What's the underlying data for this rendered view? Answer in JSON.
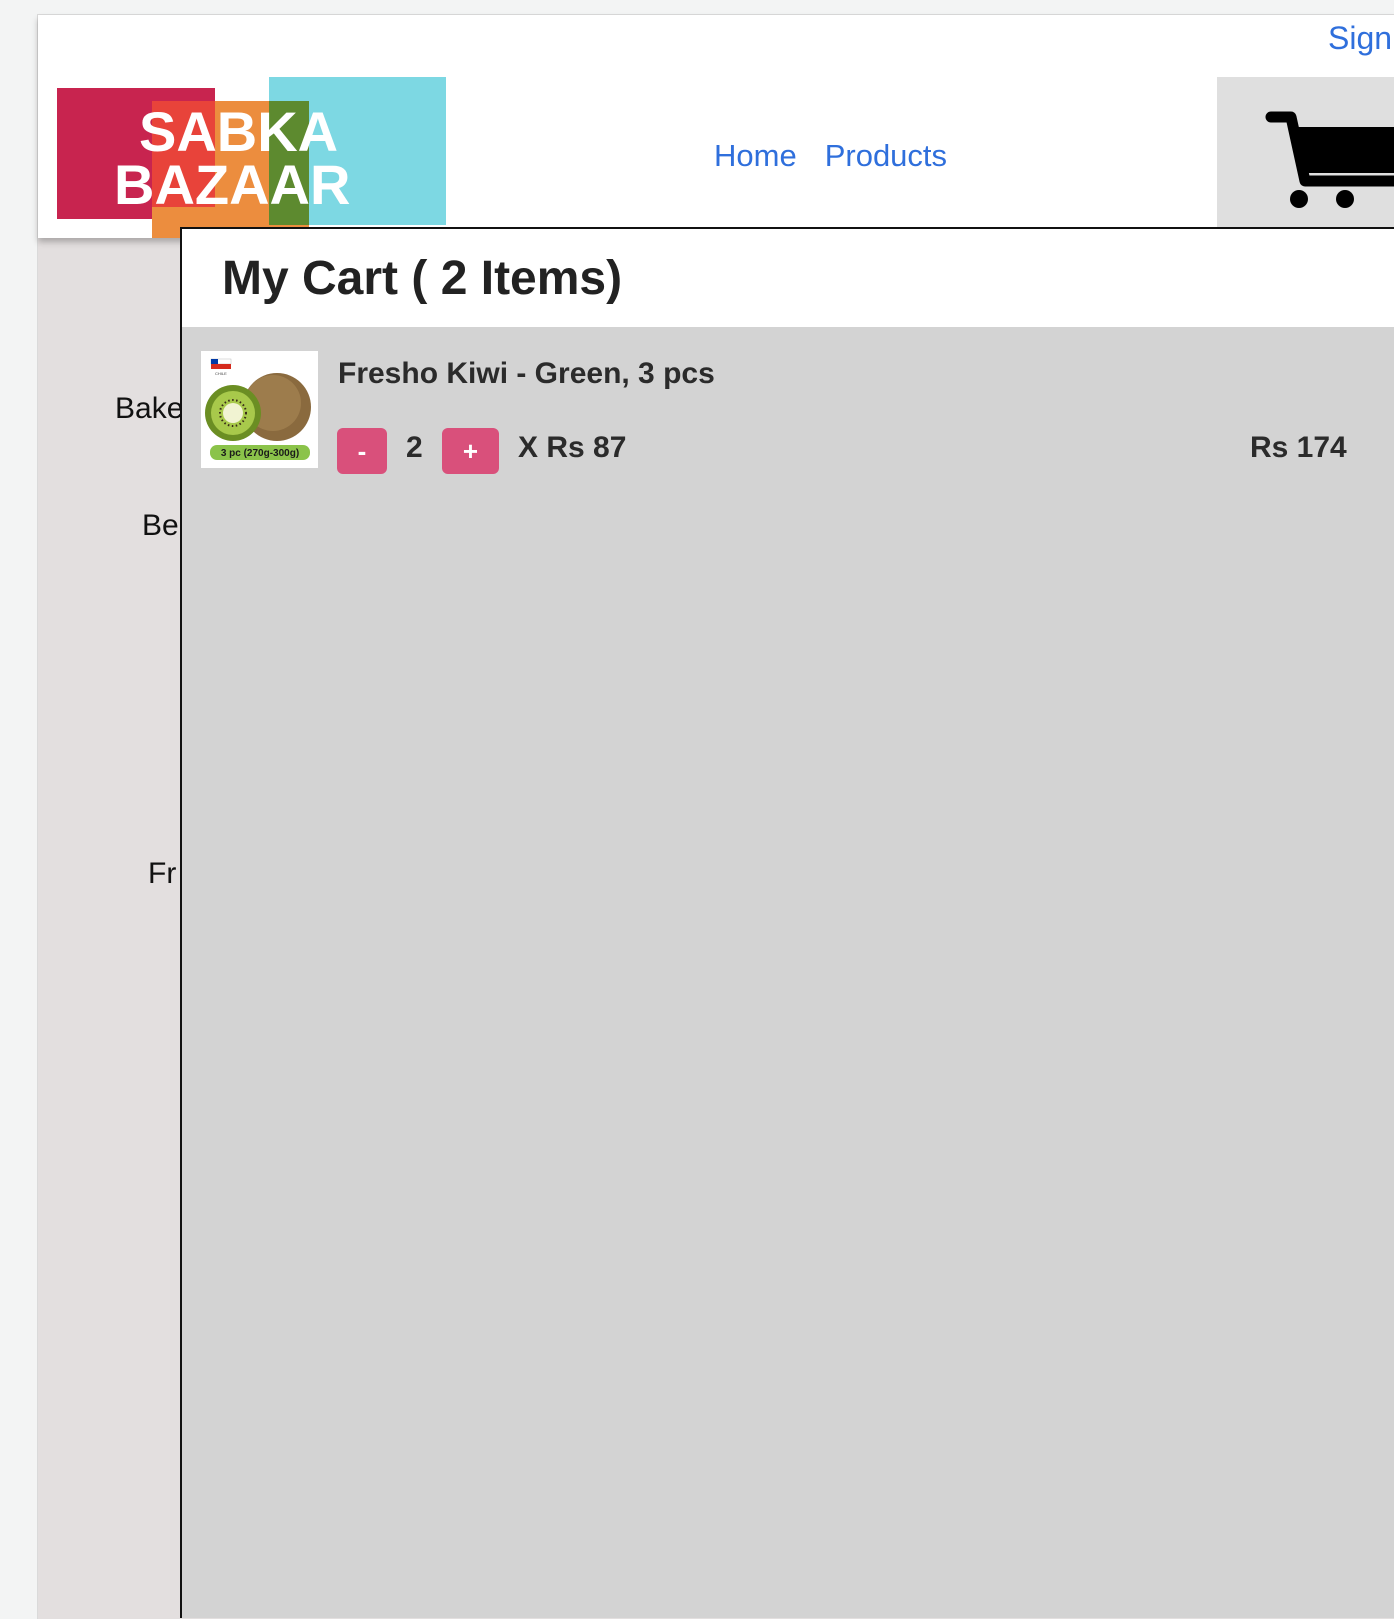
{
  "header": {
    "sign_link": "Sign",
    "logo": {
      "line1": "SABKA",
      "line2": "BAZAAR"
    },
    "nav": [
      {
        "label": "Home"
      },
      {
        "label": "Products"
      }
    ],
    "cart_icon": "cart-icon"
  },
  "sidebar": {
    "categories": [
      "Bake",
      "Be",
      "Fr"
    ]
  },
  "cart": {
    "title": "My Cart ( 2 Items)",
    "items": [
      {
        "name": "Fresho Kiwi - Green, 3 pcs",
        "image_label": "3 pc (270g-300g)",
        "image_flag_label": "CHILE",
        "decrement_label": "-",
        "quantity": "2",
        "increment_label": "+",
        "unit_price": "X Rs 87",
        "line_total": "Rs 174"
      }
    ]
  },
  "colors": {
    "link": "#2f6fdc",
    "accent": "#d9507b",
    "panel_bg": "#d3d3d3",
    "page_bg": "#e3dfdf"
  }
}
